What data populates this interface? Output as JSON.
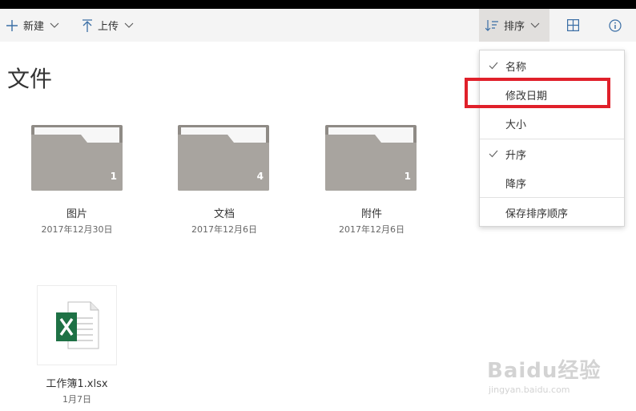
{
  "toolbar": {
    "new_label": "新建",
    "upload_label": "上传",
    "sort_label": "排序"
  },
  "page": {
    "title": "文件"
  },
  "folders": [
    {
      "name": "图片",
      "date": "2017年12月30日",
      "count": "1"
    },
    {
      "name": "文档",
      "date": "2017年12月6日",
      "count": "4"
    },
    {
      "name": "附件",
      "date": "2017年12月6日",
      "count": "1"
    }
  ],
  "files": [
    {
      "name": "工作簿1.xlsx",
      "date": "1月7日",
      "icon": "excel-icon"
    }
  ],
  "sort_menu": {
    "items": [
      {
        "label": "名称",
        "checked": true
      },
      {
        "label": "修改日期",
        "checked": false,
        "highlighted": true
      },
      {
        "label": "大小",
        "checked": false
      },
      {
        "label": "升序",
        "checked": true
      },
      {
        "label": "降序",
        "checked": false
      },
      {
        "label": "保存排序顺序",
        "checked": false
      }
    ]
  },
  "watermark": {
    "brand": "Baidu经验",
    "url": "jingyan.baidu.com"
  },
  "colors": {
    "accent": "#3a6ea5",
    "highlight": "#e0202a",
    "folder": "#a8a49f",
    "excel": "#1e7145"
  }
}
